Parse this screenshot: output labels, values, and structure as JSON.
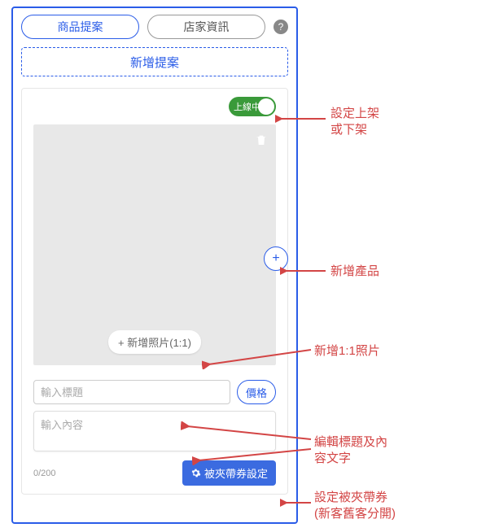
{
  "tabs": {
    "product": "商品提案",
    "store": "店家資訊"
  },
  "help_glyph": "?",
  "new_proposal_label": "新增提案",
  "toggle": {
    "label": "上線中"
  },
  "photo": {
    "add_label": "+ 新增照片(1:1)"
  },
  "add_product_glyph": "+",
  "form": {
    "title_placeholder": "輸入標題",
    "price_label": "價格",
    "content_placeholder": "輸入內容",
    "char_count": "0/200"
  },
  "coupon_button": "被夾帶券設定",
  "annotations": {
    "online": "設定上架\n或下架",
    "add_product": "新增產品",
    "add_photo": "新增1:1照片",
    "edit_text": "編輯標題及內\n容文字",
    "coupon": "設定被夾帶券\n(新客舊客分開)"
  }
}
